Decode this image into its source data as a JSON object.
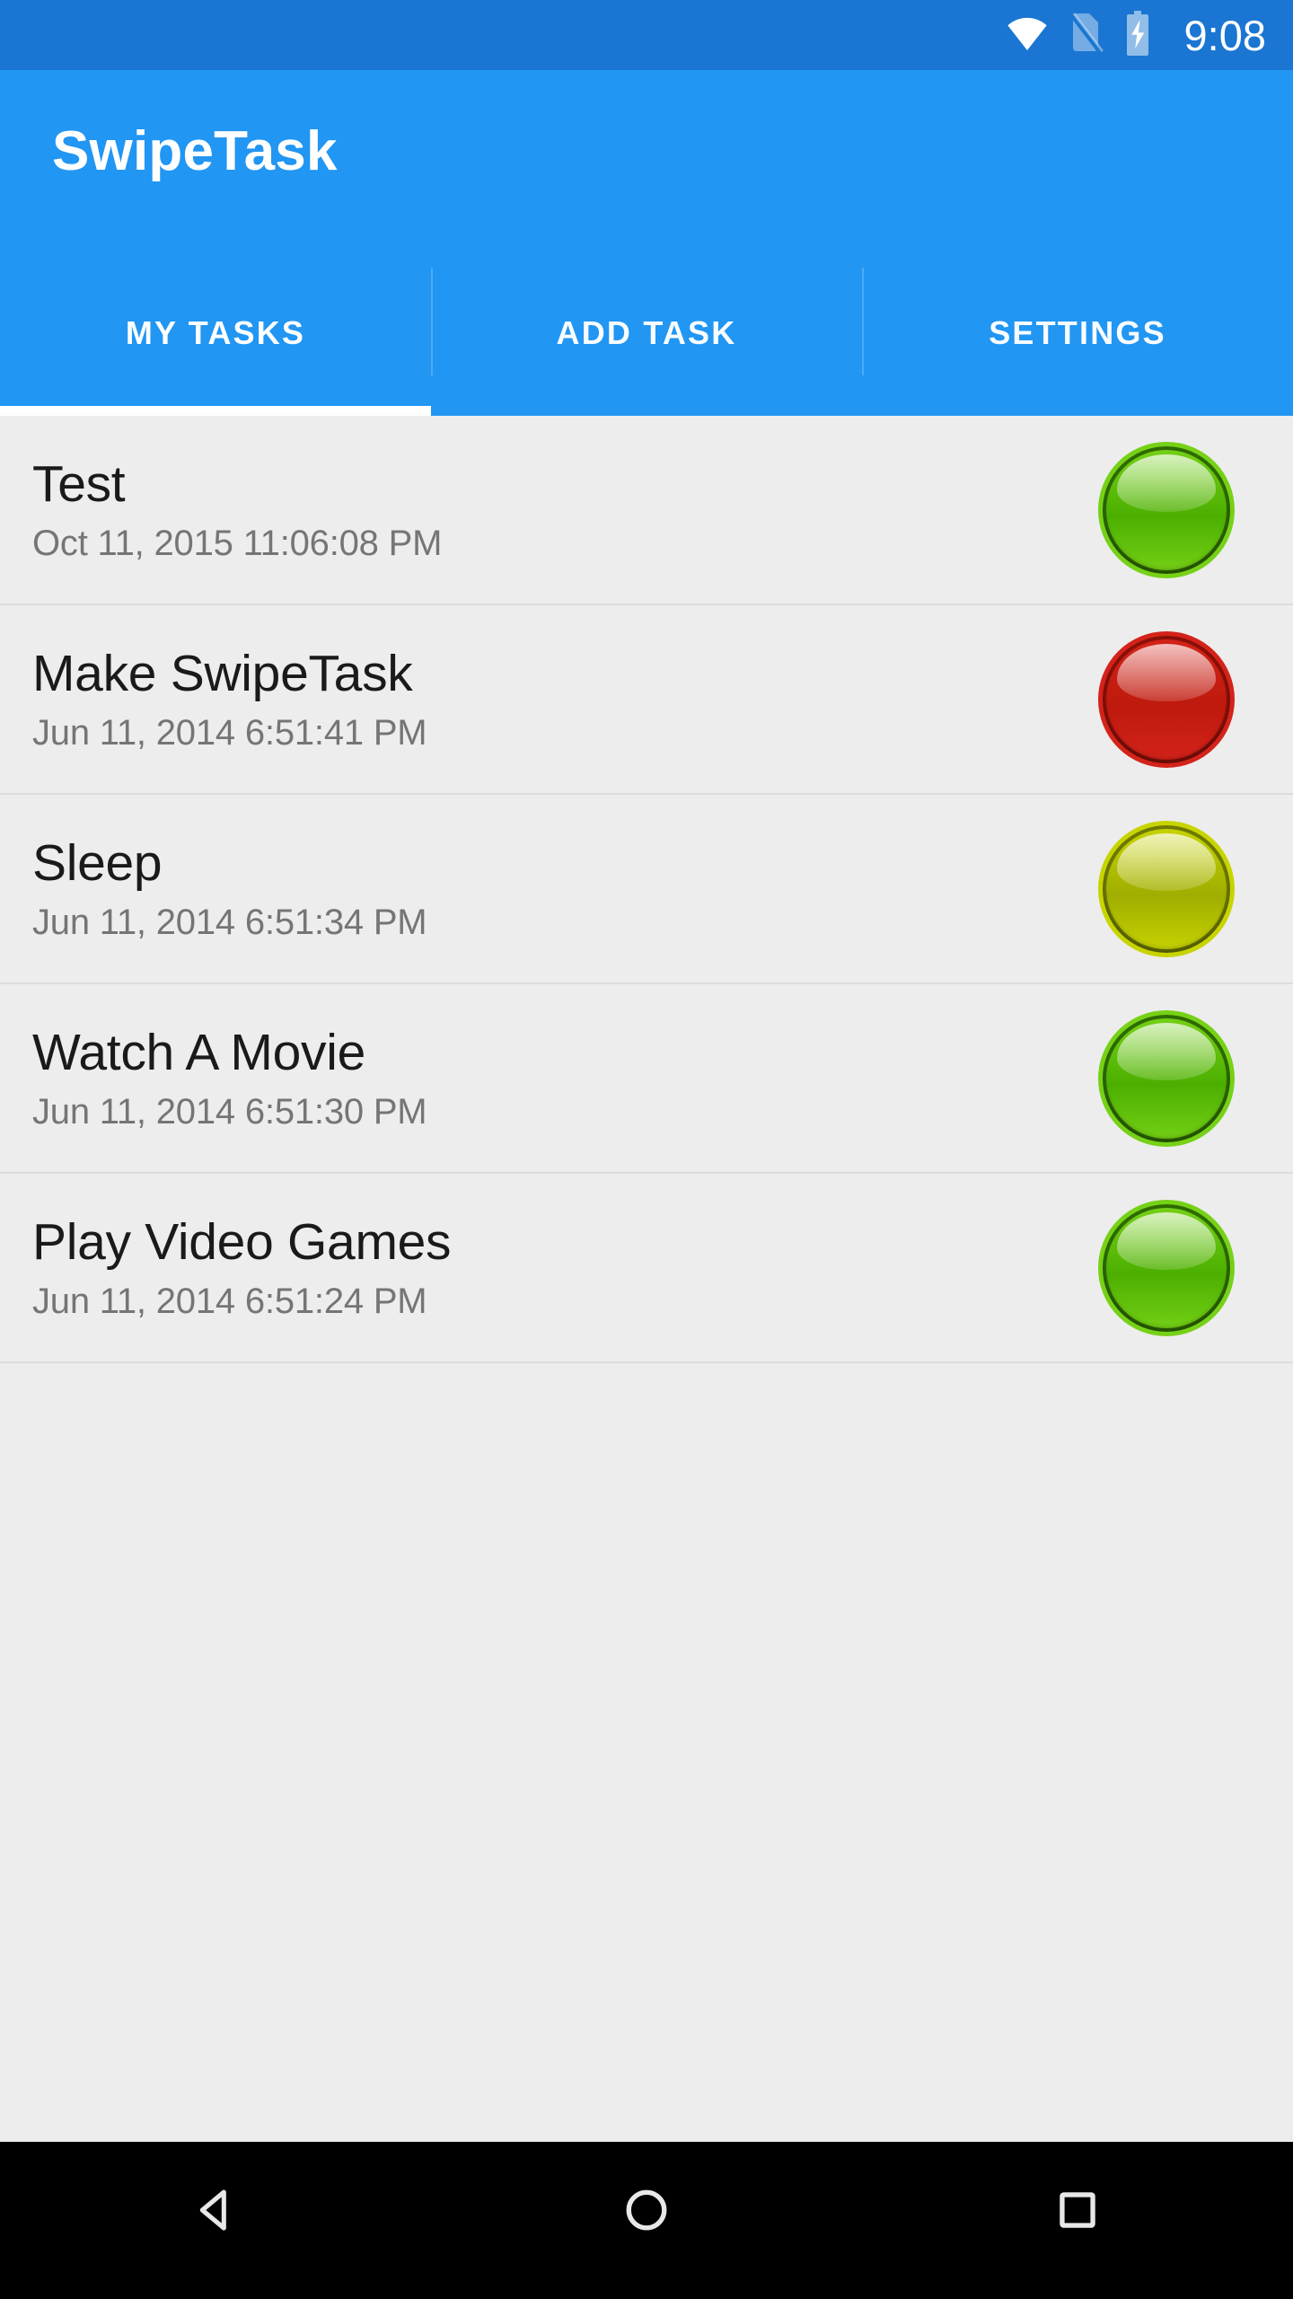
{
  "status_bar": {
    "clock": "9:08",
    "background_color": "#1A76D2",
    "icons": [
      {
        "name": "wifi-icon",
        "state": "full",
        "color": "#FFFFFF"
      },
      {
        "name": "no-sim-card-icon",
        "state": "no-sim",
        "color": "rgba(255,255,255,0.40)"
      },
      {
        "name": "battery-charging-icon",
        "state": "charging",
        "color": "rgba(255,255,255,0.55)"
      }
    ]
  },
  "app_bar": {
    "title": "SwipeTask",
    "background_color": "#2196F3",
    "text_color": "#FFFFFF"
  },
  "tabs": {
    "active_index": 0,
    "indicator_color": "#FFFFFF",
    "items": [
      {
        "label": "MY TASKS",
        "active": true
      },
      {
        "label": "ADD TASK",
        "active": false
      },
      {
        "label": "SETTINGS",
        "active": false
      }
    ]
  },
  "task_list": {
    "background_color": "#EDEDED",
    "divider_color": "#DCDCDC",
    "items": [
      {
        "title": "Test",
        "date": "Oct 11, 2015 11:06:08 PM",
        "status": "green",
        "status_color": "#4CAF00",
        "status_color_dark": "#2E6B00",
        "status_color_light": "#76D117"
      },
      {
        "title": "Make SwipeTask",
        "date": "Jun 11, 2014 6:51:41 PM",
        "status": "red",
        "status_color": "#BE1A0D",
        "status_color_dark": "#8A1008",
        "status_color_light": "#D4231A"
      },
      {
        "title": "Sleep",
        "date": "Jun 11, 2014 6:51:34 PM",
        "status": "yellow",
        "status_color": "#9FAE00",
        "status_color_dark": "#6E7A00",
        "status_color_light": "#C8D400"
      },
      {
        "title": "Watch A Movie",
        "date": "Jun 11, 2014 6:51:30 PM",
        "status": "green",
        "status_color": "#4CAF00",
        "status_color_dark": "#2E6B00",
        "status_color_light": "#76D117"
      },
      {
        "title": "Play Video Games",
        "date": "Jun 11, 2014 6:51:24 PM",
        "status": "green",
        "status_color": "#4CAF00",
        "status_color_dark": "#2E6B00",
        "status_color_light": "#76D117"
      }
    ]
  },
  "nav_bar": {
    "background_color": "#000000",
    "buttons": [
      {
        "name": "back-icon",
        "label": "Back"
      },
      {
        "name": "home-icon",
        "label": "Home"
      },
      {
        "name": "recents-icon",
        "label": "Recents"
      }
    ]
  }
}
